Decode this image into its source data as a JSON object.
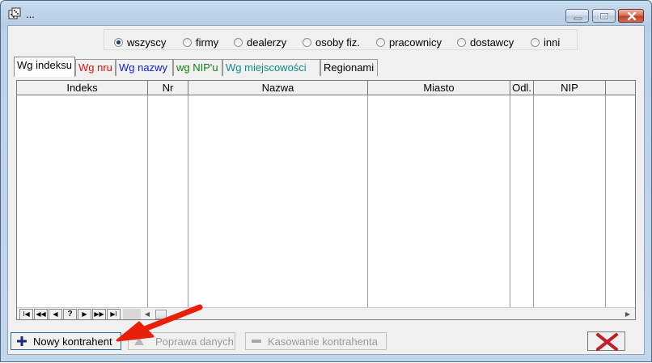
{
  "window": {
    "title": "...",
    "icon": "dice-icon"
  },
  "filters": {
    "options": [
      {
        "label": "wszyscy",
        "checked": true
      },
      {
        "label": "firmy",
        "checked": false
      },
      {
        "label": "dealerzy",
        "checked": false
      },
      {
        "label": "osoby fiz.",
        "checked": false
      },
      {
        "label": "pracownicy",
        "checked": false
      },
      {
        "label": "dostawcy",
        "checked": false
      },
      {
        "label": "inni",
        "checked": false
      }
    ]
  },
  "tabs": [
    {
      "label": "Wg indeksu",
      "color": "#000000",
      "active": true
    },
    {
      "label": "Wg nru",
      "color": "#e01010",
      "active": false
    },
    {
      "label": "Wg nazwy",
      "color": "#1020d0",
      "active": false
    },
    {
      "label": "wg NIP'u",
      "color": "#108010",
      "active": false
    },
    {
      "label": "Wg miejscowości",
      "color": "#108a8a",
      "active": false
    },
    {
      "label": "Regionami",
      "color": "#000000",
      "active": false
    }
  ],
  "table": {
    "columns": [
      "Indeks",
      "Nr",
      "Nazwa",
      "Miasto",
      "Odl.",
      "NIP"
    ],
    "rows": []
  },
  "navigator": {
    "buttons": [
      "first",
      "prior-page",
      "prior",
      "?",
      "next",
      "next-page",
      "last"
    ],
    "glyphs": [
      "I◀",
      "◀◀",
      "◀",
      "?",
      "▶",
      "▶▶",
      "▶I"
    ]
  },
  "actions": {
    "new_label": "Nowy kontrahent",
    "edit_label": "Poprawa danych",
    "delete_label": "Kasowanie kontrahenta"
  },
  "colors": {
    "accent": "#2a6aa8",
    "annotation_arrow": "#e8200a",
    "close_red": "#c0202a"
  }
}
